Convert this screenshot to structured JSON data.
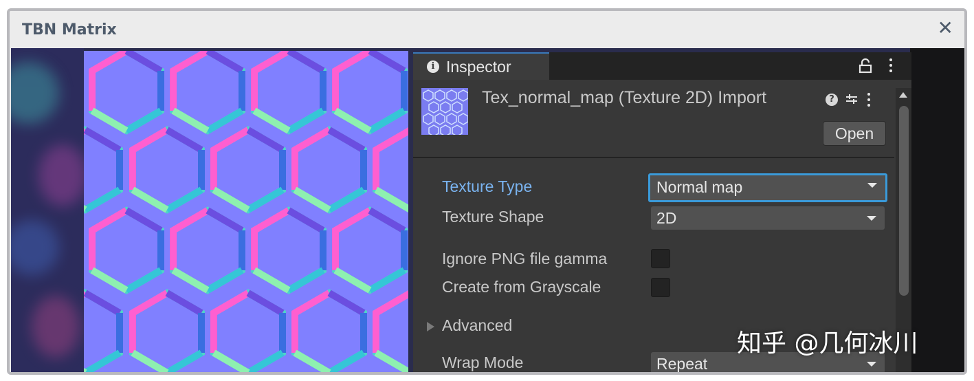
{
  "window": {
    "title": "TBN Matrix",
    "close_label": "✕"
  },
  "inspector": {
    "tab_label": "Inspector",
    "info_icon": "i",
    "asset_title": "Tex_normal_map (Texture 2D) Import",
    "help_icon": "?",
    "open_button": "Open",
    "fields": {
      "texture_type": {
        "label": "Texture Type",
        "value": "Normal map"
      },
      "texture_shape": {
        "label": "Texture Shape",
        "value": "2D"
      },
      "ignore_png_gamma": {
        "label": "Ignore PNG file gamma",
        "checked": false
      },
      "create_from_grayscale": {
        "label": "Create from Grayscale",
        "checked": false
      },
      "advanced": {
        "label": "Advanced",
        "expanded": false
      },
      "wrap_mode": {
        "label": "Wrap Mode",
        "value": "Repeat"
      }
    }
  },
  "watermark": "知乎 @几何冰川",
  "colors": {
    "normal_map_base": "#8080ff",
    "focus_outline": "#3a9ad9",
    "active_label": "#7ab3ef",
    "inspector_bg": "#383838"
  }
}
